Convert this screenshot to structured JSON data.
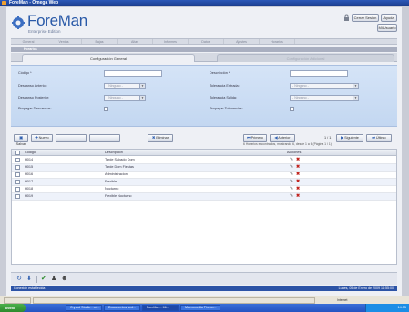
{
  "window": {
    "title": "ForeMan - Omega Web"
  },
  "logo": {
    "title": "ForeMan",
    "subtitle": "Enterprise Edition"
  },
  "header": {
    "close_session": "Cerrar Sesion",
    "help": "Ayuda",
    "user": "Mi Usuario"
  },
  "nav": {
    "items": [
      "General",
      "Ventas",
      "Bajas",
      "Altas",
      "Informes",
      "Datos",
      "Ajustes",
      "Horarios"
    ]
  },
  "section": {
    "title": "Horarios"
  },
  "tabs": {
    "active": "Configuración General",
    "inactive": "Configuración Adicional"
  },
  "form": {
    "codigo_label": "Código *",
    "codigo_value": "",
    "descripcion_label": "Descripción *",
    "descripcion_value": "",
    "desc_anterior_label": "Descanso Anterior:",
    "desc_anterior_value": "- Ninguno -",
    "tol_entrada_label": "Tolerancia Entrada:",
    "tol_entrada_value": "- Ninguno -",
    "desc_posterior_label": "Descanso Posterior:",
    "desc_posterior_value": "- Ninguno -",
    "tol_salida_label": "Tolerancia Salida:",
    "tol_salida_value": "- Ninguno -",
    "prop_descansos_label": "Propagar Descansos:",
    "prop_tolerancias_label": "Propagar Tolerancias:"
  },
  "toolbar": {
    "save": "Salvar",
    "new": "Nuevo",
    "delete": "Eliminar",
    "first": "Primero",
    "previous": "Anterior",
    "page": "1 / 1",
    "next": "Siguiente",
    "last": "Último",
    "paging_info": "6 Horarios encontrados, mostrando 6, desde 1 a 6 (Página 1 / 1)"
  },
  "grid": {
    "col_code": "Código",
    "col_desc": "Descripción",
    "col_actions": "Acciones",
    "rows": [
      {
        "code": "H014",
        "desc": "Tarde Sabado Dom"
      },
      {
        "code": "H015",
        "desc": "Tarde Dom Fiestas"
      },
      {
        "code": "H016",
        "desc": "Administracion"
      },
      {
        "code": "H017",
        "desc": "Flexible"
      },
      {
        "code": "H018",
        "desc": "Nocturno"
      },
      {
        "code": "H019",
        "desc": "Flexible Nocturno"
      }
    ]
  },
  "status": {
    "left": "Conexión establecida",
    "right": "Lunes, 05 de Enero de 2009 14:55:00"
  },
  "browser": {
    "zone": "Internet"
  },
  "taskbar": {
    "start": "Inicio",
    "tasks": [
      "Crystal Studio - ed...",
      "Documentos and...",
      "ForeMan - Mi...",
      "Macromedia Firewo..."
    ],
    "clock": "14:55"
  }
}
